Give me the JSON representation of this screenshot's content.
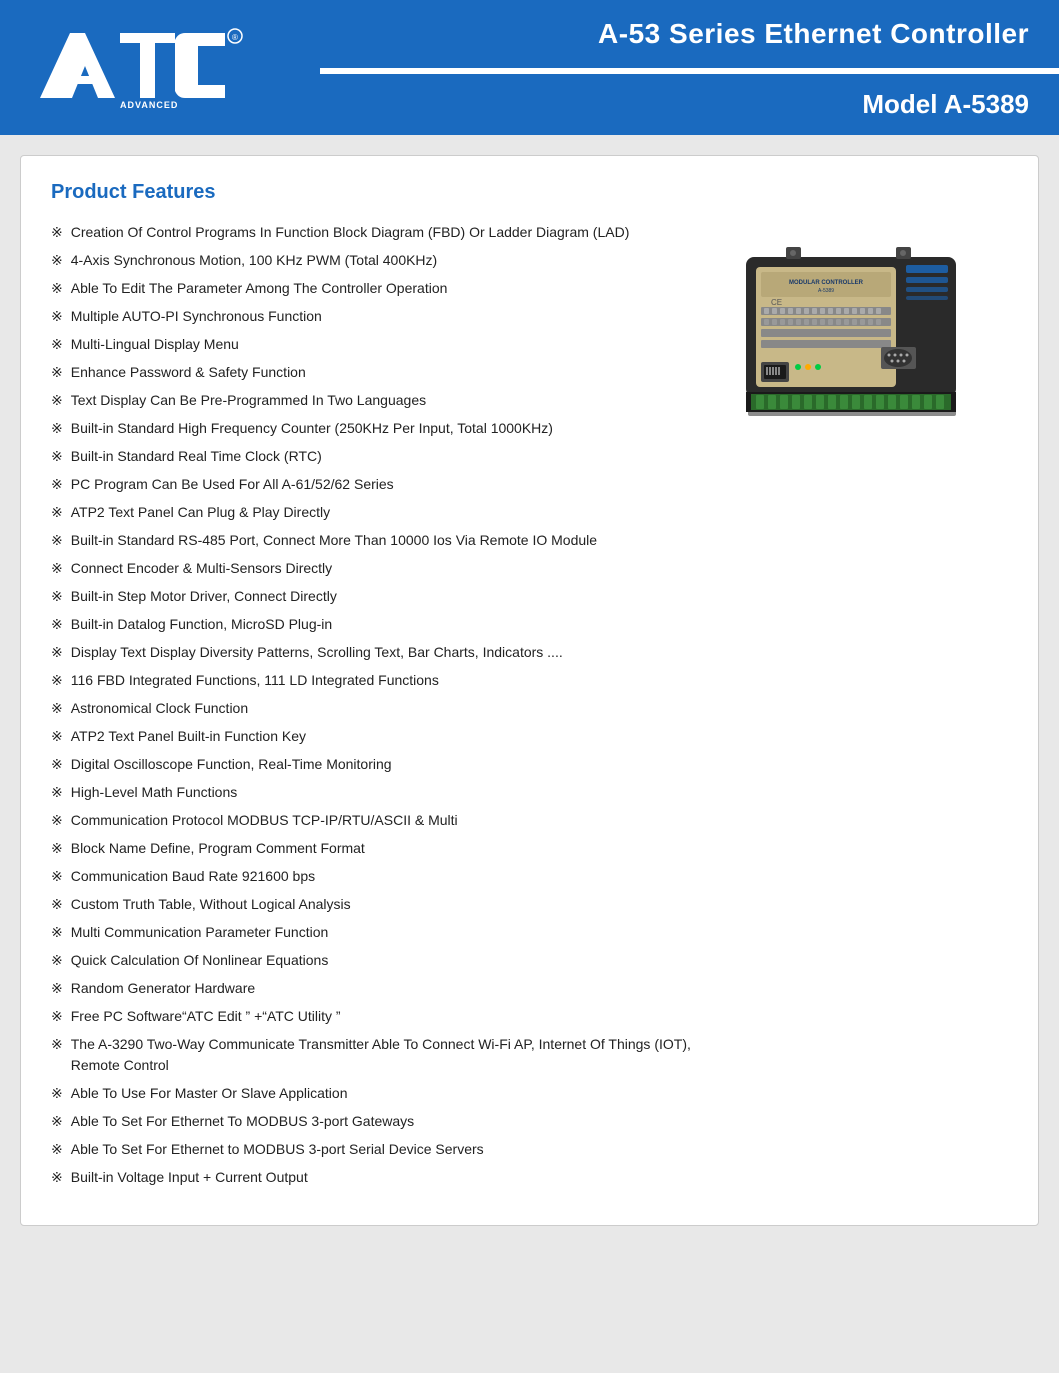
{
  "header": {
    "logo_alt": "ATC Advanced Technology",
    "title_line1": "A-53 Series Ethernet Controller",
    "title_line2": "Model A-5389"
  },
  "product": {
    "section_title": "Product Features",
    "features": [
      "Creation Of Control Programs In Function Block Diagram (FBD) Or Ladder Diagram (LAD)",
      "4-Axis Synchronous Motion, 100 KHz PWM (Total 400KHz)",
      "Able To Edit The Parameter Among The Controller Operation",
      "Multiple AUTO-PI Synchronous Function",
      "Multi-Lingual Display Menu",
      "Enhance Password & Safety Function",
      "Text Display Can Be Pre-Programmed In Two Languages",
      "Built-in Standard High Frequency Counter (250KHz Per Input, Total 1000KHz)",
      "Built-in Standard Real Time Clock (RTC)",
      "PC Program Can Be Used For All A-61/52/62 Series",
      "ATP2 Text Panel Can Plug & Play Directly",
      "Built-in Standard RS-485 Port, Connect More Than 10000 Ios Via Remote IO Module",
      "Connect Encoder & Multi-Sensors Directly",
      "Built-in Step Motor Driver, Connect Directly",
      "Built-in Datalog Function, MicroSD Plug-in",
      "Display Text Display Diversity Patterns, Scrolling Text, Bar Charts, Indicators ....",
      "116 FBD Integrated Functions, 111 LD Integrated Functions",
      "Astronomical Clock Function",
      "ATP2 Text Panel Built-in Function Key",
      "Digital Oscilloscope Function, Real-Time Monitoring",
      "High-Level Math Functions",
      "Communication Protocol MODBUS TCP-IP/RTU/ASCII & Multi",
      "Block Name Define, Program Comment Format",
      "Communication Baud Rate 921600 bps",
      "Custom Truth Table, Without Logical Analysis",
      "Multi Communication Parameter Function",
      "Quick Calculation Of Nonlinear Equations",
      "Random Generator Hardware",
      "Free PC Software“ATC Edit ” +“ATC Utility ”",
      "The A-3290 Two-Way Communicate Transmitter Able To Connect Wi-Fi AP, Internet Of Things (IOT), Remote Control",
      "Able To Use For Master Or Slave Application",
      "Able To Set For Ethernet To MODBUS 3-port Gateways",
      "Able To Set For Ethernet to MODBUS 3-port Serial Device Servers",
      "Built-in Voltage Input + Current Output"
    ],
    "bullet": "※"
  }
}
